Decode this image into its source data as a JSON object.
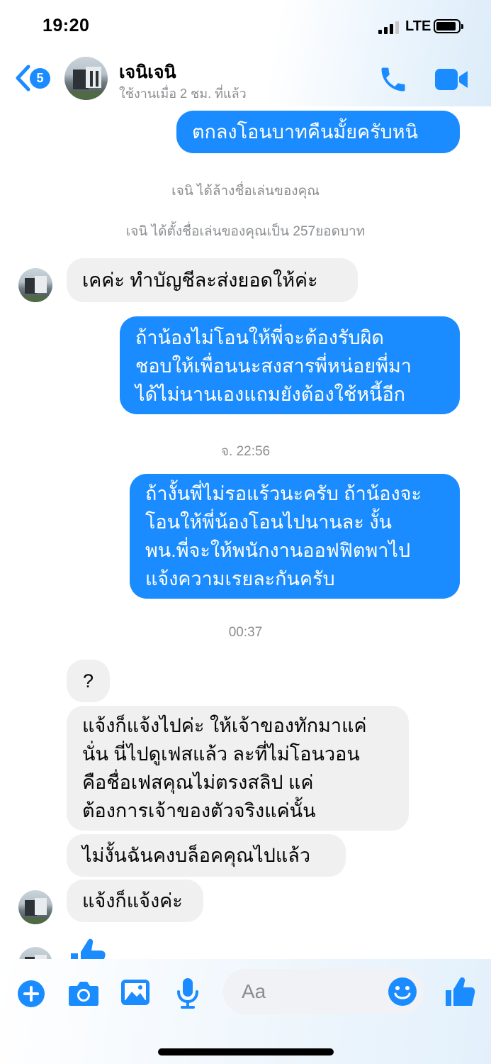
{
  "status_bar": {
    "time": "19:20",
    "network": "LTE"
  },
  "header": {
    "unread_count": "5",
    "contact_name": "เจนิเจนิ",
    "last_active": "ใช้งานเมื่อ 2 ชม. ที่แล้ว"
  },
  "messages": {
    "m1": "ตกลงโอนบาทคืนมั้ยครับหนิ",
    "sys1": "เจนิ ได้ล้างชื่อเล่นของคุณ",
    "sys2": "เจนิ ได้ตั้งชื่อเล่นของคุณเป็น 257ยอดบาท",
    "m2": "เคค่ะ ทำบัญชีละส่งยอดให้ค่ะ",
    "m3_lines": [
      "ถ้าน้องไม่โอนให้พี่จะต้องรับผิด",
      "ชอบให้เพื่อนนะสงสารพี่หน่อยพี่มา",
      "ได้ไม่นานเองแถมยังต้องใช้หนี้อีก"
    ],
    "ts1": "จ. 22:56",
    "m4_lines": [
      "ถ้างั้นพี่ไม่รอแร้วนะครับ ถ้าน้องจะ",
      "โอนให้พี่น้องโอนไปนานละ งั้น",
      "พน.พี่จะให้พนักงานออฟฟิตพาไป",
      "แจ้งความเรยละกันครับ"
    ],
    "ts2": "00:37",
    "m5": "?",
    "m6_lines": [
      "แจ้งก็แจ้งไปค่ะ ให้เจ้าของทักมาแค่",
      "นั่น นี่ไปดูเฟสแล้ว ละที่ไม่โอนวอน",
      "คือชื่อเฟสคุณไม่ตรงสลิป แค่",
      "ต้องการเจ้าของตัวจริงแค่นั้น"
    ],
    "m7": "ไม่งั้นฉันคงบล็อคคุณไปแล้ว",
    "m8": "แจ้งก็แจ้งค่ะ"
  },
  "composer": {
    "placeholder": "Aa"
  },
  "colors": {
    "accent": "#1a8cff",
    "incoming_bubble": "#f0f0f0",
    "meta_text": "#8a8d91"
  },
  "icons": [
    "back-chevron-icon",
    "phone-icon",
    "video-camera-icon",
    "plus-circle-icon",
    "camera-icon",
    "photo-icon",
    "microphone-icon",
    "emoji-icon",
    "thumbs-up-icon"
  ]
}
